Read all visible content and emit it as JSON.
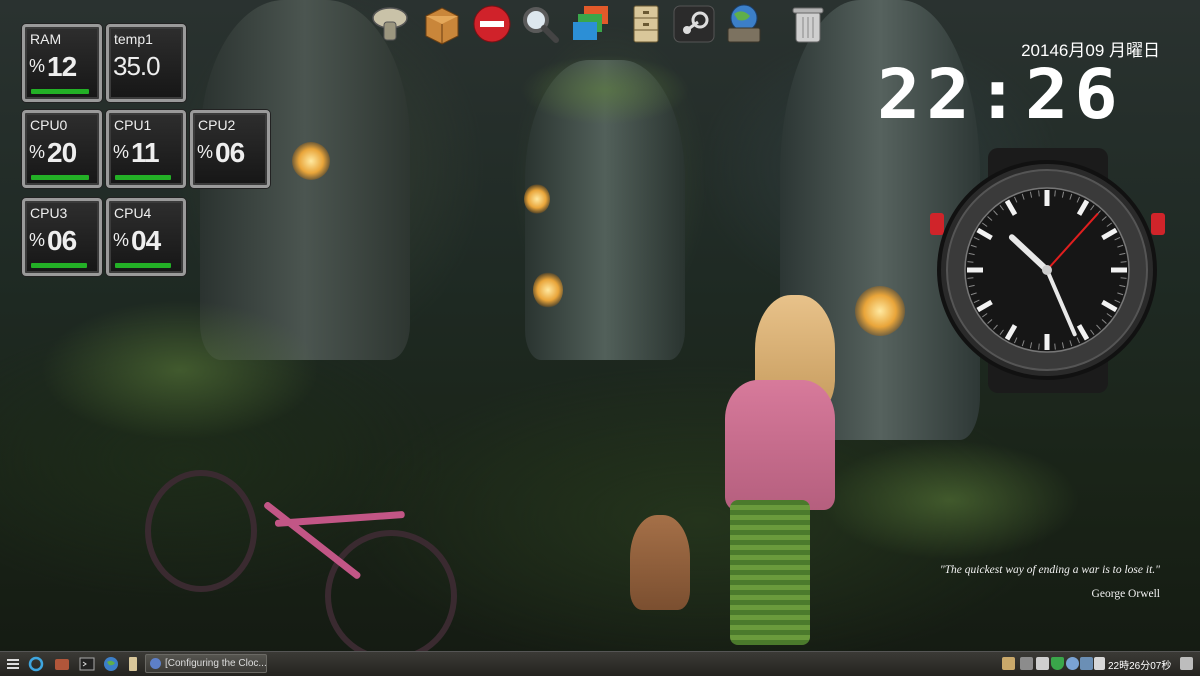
{
  "widgets": [
    {
      "label": "RAM",
      "pct": "%",
      "value": "12",
      "bar": 0.9
    },
    {
      "label": "temp1",
      "pct": "",
      "value": "35.0",
      "bar": 0
    },
    {
      "label": "CPU0",
      "pct": "%",
      "value": "20",
      "bar": 0.9
    },
    {
      "label": "CPU1",
      "pct": "%",
      "value": "11",
      "bar": 0.85
    },
    {
      "label": "CPU2",
      "pct": "%",
      "value": "06",
      "bar": 0
    },
    {
      "label": "CPU3",
      "pct": "%",
      "value": "06",
      "bar": 0.85
    },
    {
      "label": "CPU4",
      "pct": "%",
      "value": "04",
      "bar": 0.85
    }
  ],
  "dock": {
    "items": [
      "mushroom-icon",
      "box-icon",
      "no-entry-icon",
      "magnifier-icon",
      "windows-icon",
      "cabinet-icon",
      "steam-icon",
      "globe-tools-icon",
      "trash-icon"
    ]
  },
  "clock": {
    "date": "20146月09 月曜日",
    "time": "22:26",
    "analog": {
      "hour": 10,
      "minute": 26,
      "second": 7
    }
  },
  "quote": {
    "text": "\"The quickest way of ending a war is to lose it.\"",
    "author": "George Orwell"
  },
  "taskbar": {
    "task_label": "[Configuring the Cloc...",
    "tray_time": "22時26分07秒"
  },
  "colors": {
    "widget_bar": "#23b026",
    "watch_hand": "#e01e1e"
  }
}
